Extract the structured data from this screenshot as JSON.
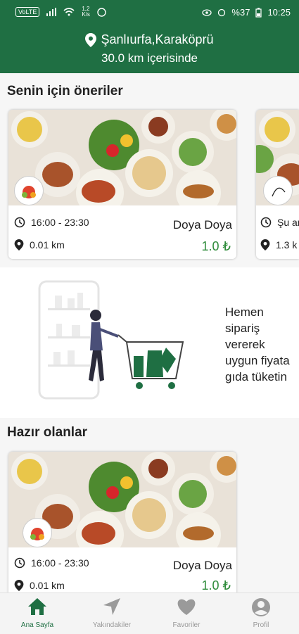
{
  "status_bar": {
    "carrier_badge": "VoLTE",
    "speed": "1,2\nK/s",
    "battery": "%37",
    "time": "10:25"
  },
  "header": {
    "location": "Şanlıurfa,Karaköprü",
    "radius": "30.0 km içerisinde"
  },
  "recommendations": {
    "title": "Senin için öneriler",
    "cards": [
      {
        "hours": "16:00 - 23:30",
        "name": "Doya Doya",
        "distance": "0.01 km",
        "price": "1.0 ₺",
        "logo_text": "Doya Doya"
      },
      {
        "hours": "Şu an",
        "name": "",
        "distance": "1.3 k",
        "price": ""
      }
    ]
  },
  "promo": {
    "text_lines": [
      "Hemen",
      "sipariş",
      "vererek",
      "uygun fiyata",
      "gıda tüketin"
    ]
  },
  "available": {
    "title": "Hazır olanlar",
    "cards": [
      {
        "hours": "16:00 - 23:30",
        "name": "Doya Doya",
        "distance": "0.01 km",
        "price": "1.0 ₺",
        "logo_text": "Doya Doya"
      }
    ]
  },
  "tabs": [
    {
      "label": "Ana Sayfa",
      "icon": "home-icon",
      "active": true
    },
    {
      "label": "Yakındakiler",
      "icon": "navigation-arrow-icon",
      "active": false
    },
    {
      "label": "Favoriler",
      "icon": "heart-icon",
      "active": false
    },
    {
      "label": "Profil",
      "icon": "person-icon",
      "active": false
    }
  ],
  "colors": {
    "brand_green": "#1f6f43",
    "price_green": "#2e8b3a"
  }
}
